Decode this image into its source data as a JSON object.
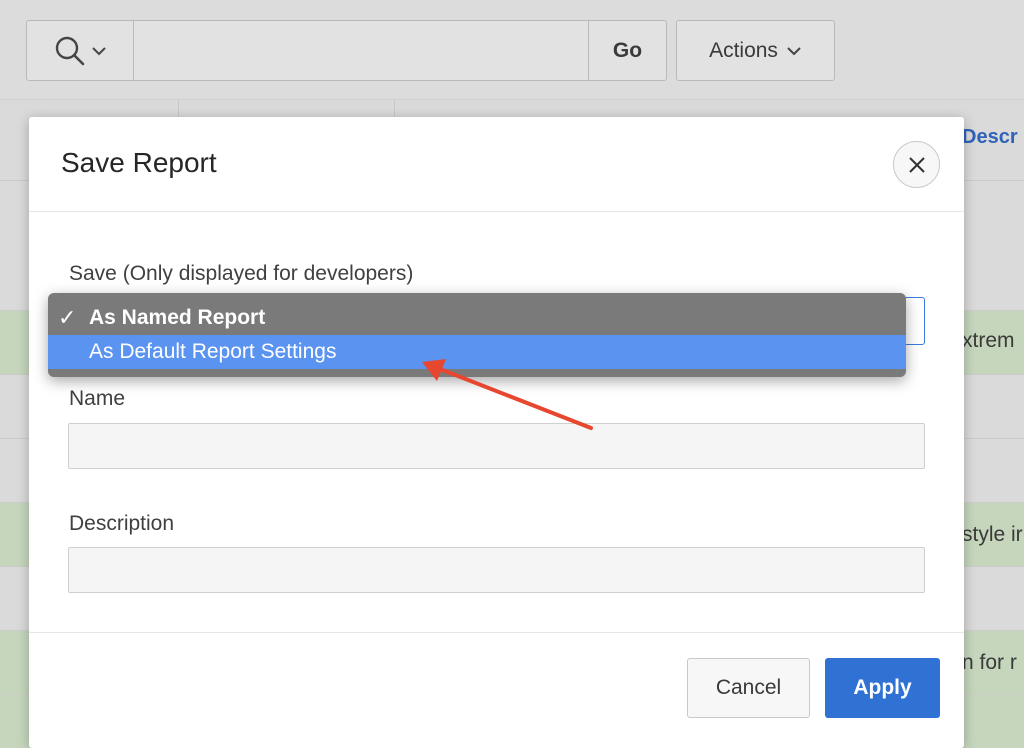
{
  "toolbar": {
    "search_icon": "search-icon",
    "go_label": "Go",
    "actions_label": "Actions"
  },
  "background_report": {
    "header_text": "Descr",
    "row_fragments": [
      "xtrem",
      "style ir",
      "n for r"
    ]
  },
  "modal": {
    "title": "Save Report",
    "close_icon": "close-icon",
    "save_label": "Save (Only displayed for developers)",
    "save_options": [
      {
        "label": "As Named Report",
        "checked": true
      },
      {
        "label": "As Default Report Settings",
        "highlighted": true
      }
    ],
    "name_label": "Name",
    "name_value": "",
    "description_label": "Description",
    "description_value": "",
    "cancel_label": "Cancel",
    "apply_label": "Apply"
  },
  "colors": {
    "accent": "#2f72d4",
    "menu_highlight": "#5b93f0",
    "annotation_arrow": "#e8472f"
  }
}
